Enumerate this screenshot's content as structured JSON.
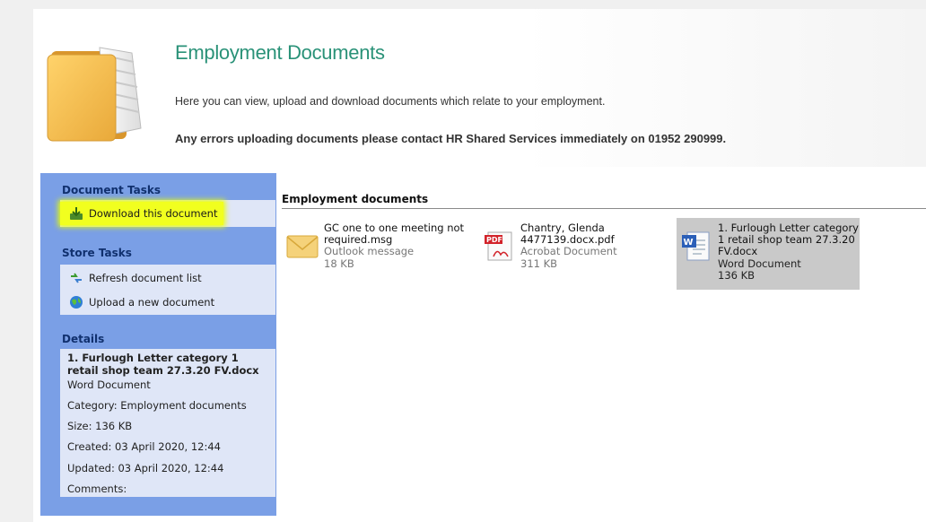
{
  "header": {
    "title": "Employment Documents",
    "intro": "Here you can view, upload and download documents which relate to your employment.",
    "notice": "Any errors uploading documents please contact HR Shared Services immediately on 01952 290999."
  },
  "taskpane": {
    "document_tasks": {
      "title": "Document Tasks",
      "items": [
        {
          "label": "Download this document",
          "icon": "download-icon"
        }
      ]
    },
    "store_tasks": {
      "title": "Store Tasks",
      "items": [
        {
          "label": "Refresh document list",
          "icon": "refresh-icon"
        },
        {
          "label": "Upload a new document",
          "icon": "globe-upload-icon"
        }
      ]
    },
    "details": {
      "title": "Details",
      "file_name": "1. Furlough Letter category 1 retail shop team 27.3.20 FV.docx",
      "file_type": "Word Document",
      "category": "Category: Employment documents",
      "size": "Size: 136 KB",
      "created": "Created: 03 April 2020, 12:44",
      "updated": "Updated: 03 April 2020, 12:44",
      "comments": "Comments:"
    }
  },
  "main": {
    "section_title": "Employment documents",
    "documents": [
      {
        "name": "GC one to one meeting not required.msg",
        "type": "Outlook message",
        "size": "18 KB",
        "icon": "envelope-icon",
        "selected": false
      },
      {
        "name": "Chantry, Glenda 4477139.docx.pdf",
        "type": "Acrobat Document",
        "size": "311 KB",
        "icon": "pdf-icon",
        "selected": false
      },
      {
        "name": "1. Furlough Letter category 1 retail shop team 27.3.20 FV.docx",
        "type": "Word Document",
        "size": "136 KB",
        "icon": "word-doc-icon",
        "selected": true
      }
    ]
  },
  "colors": {
    "title": "#2a9278",
    "taskpane": "#7a9fe6",
    "section_body": "#dfe6f7",
    "highlight": "#f1ff1f",
    "selected": "#c9c9c9"
  }
}
